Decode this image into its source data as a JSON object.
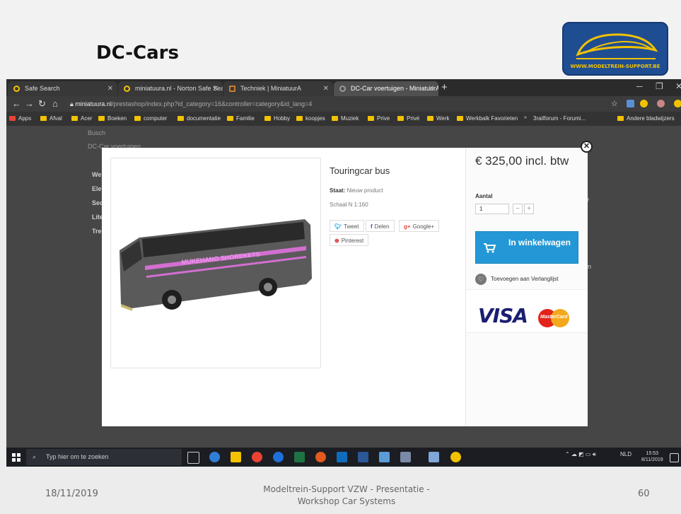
{
  "slide": {
    "title": "DC-Cars",
    "logo_url": "WWW.MODELTREIN-SUPPORT.BE",
    "footer_date": "18/11/2019",
    "footer_text_line1": "Modeltrein-Support  VZW - Presentatie -",
    "footer_text_line2": "Workshop  Car Systems",
    "page_number": "60"
  },
  "browser": {
    "tabs": [
      {
        "label": "Safe Search"
      },
      {
        "label": "miniatuura.nl - Norton Safe Sear"
      },
      {
        "label": "Techniek | MiniatuurA"
      },
      {
        "label": "DC-Car voertuigen - MiniatuurA"
      }
    ],
    "url_host": "miniatuura.nl",
    "url_path": "/prestashop/index.php?id_category=16&controller=category&id_lang=4",
    "bookmarks": [
      "Apps",
      "Afval",
      "Acer",
      "Boeken",
      "computer",
      "documentatie",
      "Familie",
      "Hobby",
      "koopjes",
      "Muziek",
      "Prive",
      "Privé",
      "Werk",
      "Werkbalk Favorieten",
      "3railforum - Forumi...",
      "Andere bladwijzers"
    ]
  },
  "background_page": {
    "menu": [
      "Busch",
      "DC-Car voertuigen",
      "We",
      "Ele",
      "Sec",
      "Lite",
      "Tre"
    ],
    "side_fragments": [
      "e",
      "n"
    ]
  },
  "product": {
    "name": "Touringcar bus",
    "condition_label": "Staat:",
    "condition_value": "Nieuw product",
    "scale": "Schaal N  1:160",
    "share": {
      "tweet": "Tweet",
      "delen": "Delen",
      "google": "Google+",
      "pinterest": "Pinterest"
    },
    "bus_logo_text": "MUKEHANO SHOREKETS"
  },
  "buybox": {
    "price": "€ 325,00 incl. btw",
    "quantity_label": "Aantal",
    "quantity_value": "1",
    "minus": "−",
    "plus": "+",
    "cart_button": "In winkelwagen",
    "wishlist": "Toevoegen aan Verlanglijst",
    "visa": "VISA",
    "mastercard": "MasterCard"
  },
  "taskbar": {
    "search_placeholder": "Typ hier om te zoeken",
    "language": "NLD",
    "time": "15:53",
    "date": "8/11/2019"
  },
  "colors": {
    "cart_button": "#2498d6",
    "visa_blue": "#1a1f71",
    "mastercard_red": "#e2231a",
    "mastercard_orange": "#f4a81c",
    "bus_body": "#5a5a5a",
    "logo_bg": "#1f4d92"
  },
  "icons": [
    "windows-icon",
    "search-icon",
    "cart-icon",
    "heart-icon",
    "close-icon",
    "star-icon",
    "back-icon",
    "forward-icon",
    "reload-icon",
    "home-icon",
    "lock-icon"
  ]
}
